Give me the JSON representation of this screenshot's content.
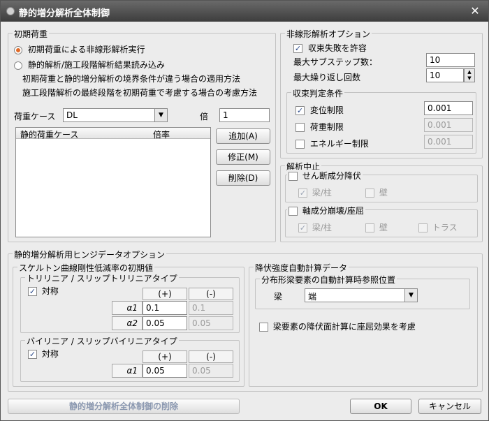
{
  "window": {
    "title": "静的増分解析全体制御",
    "close_symbol": "✕"
  },
  "initial_load": {
    "legend": "初期荷重",
    "radio_nonlinear": "初期荷重による非線形解析実行",
    "radio_import": "静的解析/施工段階解析結果読み込み",
    "note1": "初期荷重と静的増分解析の境界条件が違う場合の適用方法",
    "note2": "施工段階解析の最終段階を初期荷重で考慮する場合の考慮方法",
    "load_case_label": "荷重ケース",
    "load_case_value": "DL",
    "factor_label": "倍",
    "factor_value": "1",
    "col_case": "静的荷重ケース",
    "col_factor": "倍率",
    "add_button": "追加(A)",
    "modify_button": "修正(M)",
    "delete_button": "削除(D)"
  },
  "nonlinear_options": {
    "legend": "非線形解析オプション",
    "allow_nonconvergence": "収束失敗を許容",
    "max_substep_label": "最大サブステップ数：",
    "max_substep_value": "10",
    "max_iter_label": "最大繰り返し回数",
    "max_iter_value": "10",
    "convergence": {
      "legend": "収束判定条件",
      "displacement": "変位制限",
      "displacement_value": "0.001",
      "load": "荷重制限",
      "load_value": "0.001",
      "energy": "エネルギー制限",
      "energy_value": "0.001"
    }
  },
  "analysis_stop": {
    "legend": "解析中止",
    "shear_yield": "せん断成分降伏",
    "shear_beam_column": "梁/柱",
    "shear_wall": "壁",
    "axial_collapse": "軸成分崩壊/座屈",
    "axial_beam_column": "梁/柱",
    "axial_wall": "壁",
    "axial_truss": "トラス"
  },
  "hinge_options": {
    "legend": "静的増分解析用ヒンジデータオプション",
    "skeleton": {
      "legend": "スケルトン曲線剛性低減率の初期値",
      "trilinear": {
        "legend": "トリリニア / スリップトリリニアタイプ",
        "symmetric": "対称",
        "col_plus": "(+)",
        "col_minus": "(-)",
        "alpha1_label": "α1",
        "alpha1_plus": "0.1",
        "alpha1_minus": "0.1",
        "alpha2_label": "α2",
        "alpha2_plus": "0.05",
        "alpha2_minus": "0.05"
      },
      "bilinear": {
        "legend": "バイリニア / スリップバイリニアタイプ",
        "symmetric": "対称",
        "col_plus": "(+)",
        "col_minus": "(-)",
        "alpha1_label": "α1",
        "alpha1_plus": "0.05",
        "alpha1_minus": "0.05"
      }
    },
    "yield_strength": {
      "legend": "降伏強度自動計算データ",
      "distributed": {
        "legend": "分布形梁要素の自動計算時参照位置",
        "beam_label": "梁",
        "beam_value": "端"
      },
      "buckling_check": "梁要素の降伏面計算に座屈効果を考慮"
    }
  },
  "footer": {
    "delete_all": "静的増分解析全体制御の削除",
    "ok": "OK",
    "cancel": "キャンセル"
  },
  "icons": {
    "check": "✓",
    "dropdown": "▼",
    "spin_up": "▲",
    "spin_down": "▼"
  }
}
